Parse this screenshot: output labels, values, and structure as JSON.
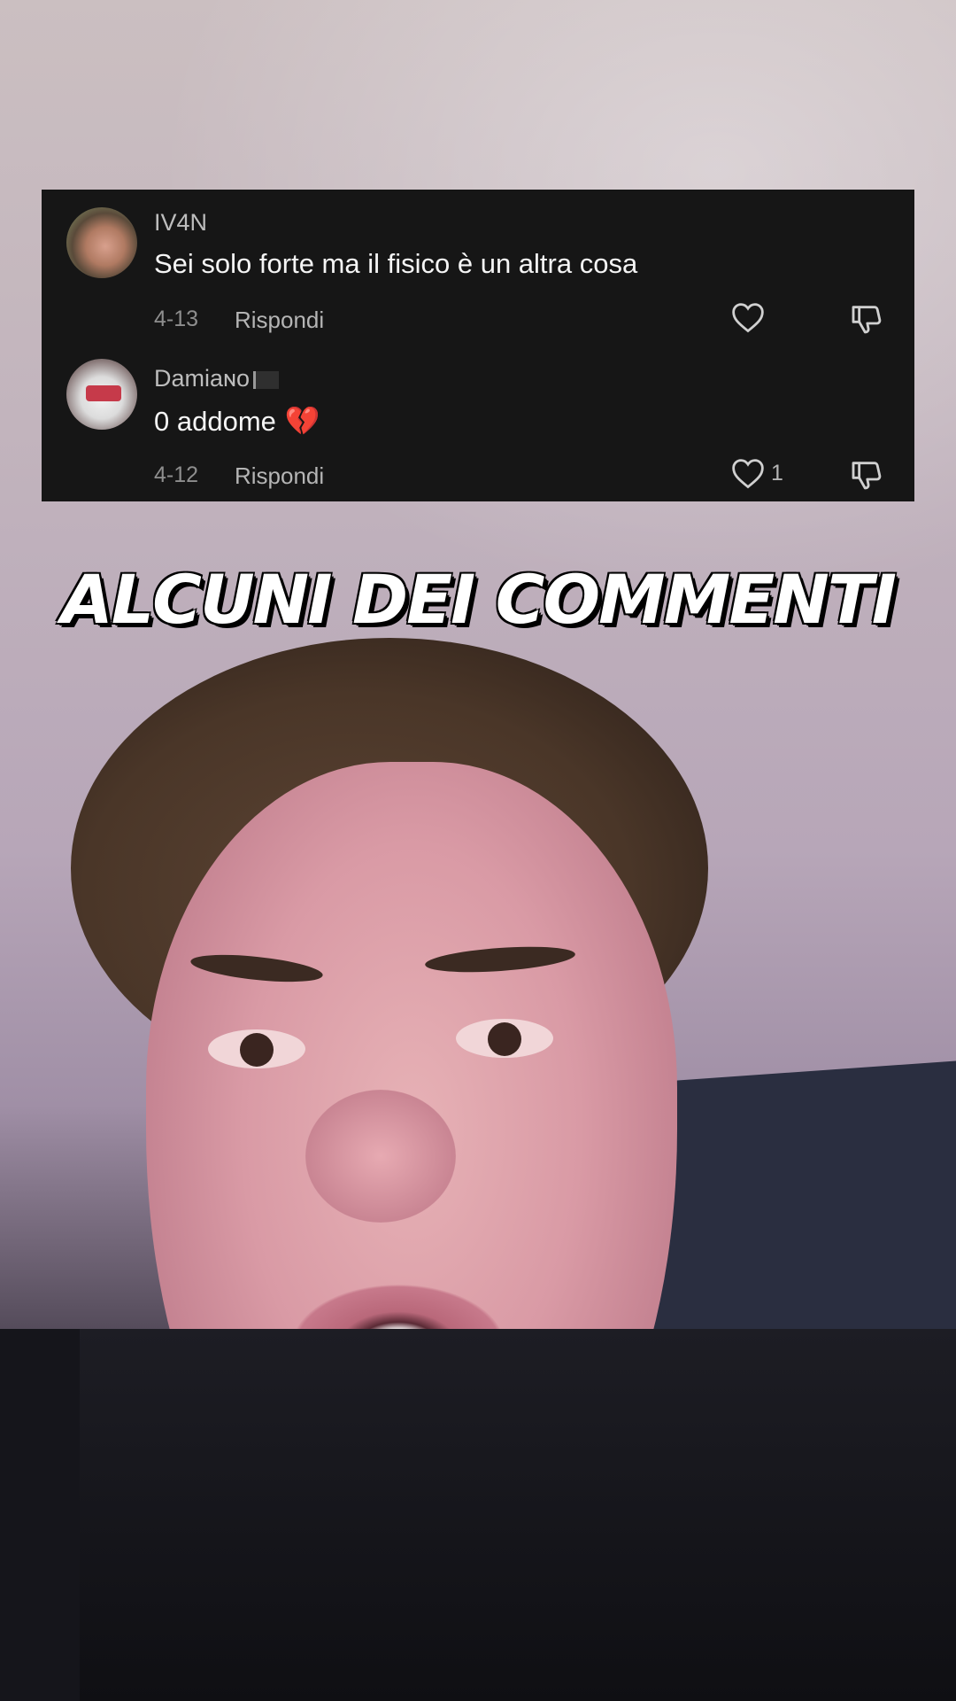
{
  "comments": [
    {
      "username": "IV4N",
      "text": "Sei solo forte ma il fisico è un altra cosa",
      "date": "4-13",
      "reply_label": "Rispondi",
      "like_count": ""
    },
    {
      "username": "Damiaɴo",
      "text": "0 addome",
      "emoji": "💔",
      "date": "4-12",
      "reply_label": "Rispondi",
      "like_count": "1"
    }
  ],
  "headline": "ALCUNI DEI COMMENTI",
  "colors": {
    "card_bg": "#161616",
    "username": "#bdbdbd",
    "comment_text": "#f5f5f5",
    "meta": "#8e8e8e",
    "headline_fill": "#ffffff",
    "headline_outline": "#000000"
  },
  "icons": [
    "heart-outline-icon",
    "dislike-icon",
    "broken-heart-emoji",
    "black-flag-emoji"
  ]
}
